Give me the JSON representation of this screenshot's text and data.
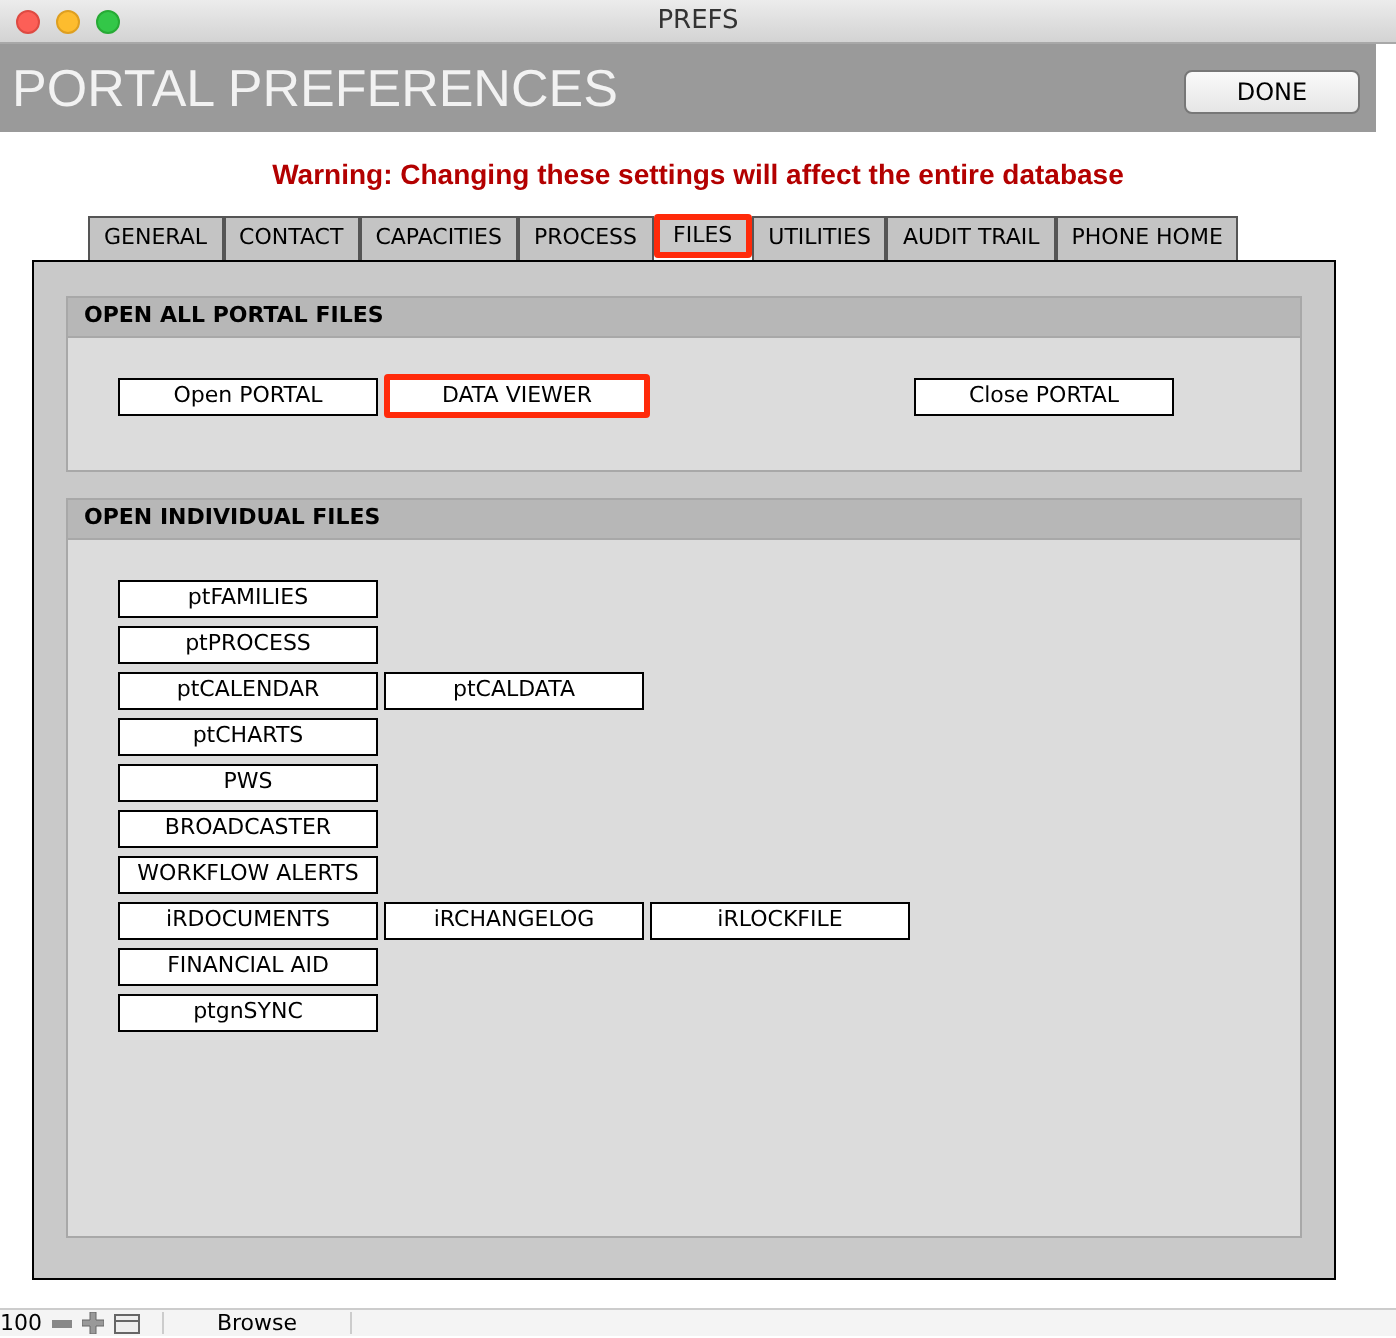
{
  "window": {
    "title": "PREFS"
  },
  "header": {
    "title": "PORTAL PREFERENCES",
    "done_button": "DONE"
  },
  "warning": "Warning: Changing these settings will affect the entire database",
  "tabs": [
    {
      "label": "GENERAL",
      "selected": false
    },
    {
      "label": "CONTACT",
      "selected": false
    },
    {
      "label": "CAPACITIES",
      "selected": false
    },
    {
      "label": "PROCESS",
      "selected": false
    },
    {
      "label": "FILES",
      "selected": true
    },
    {
      "label": "UTILITIES",
      "selected": false
    },
    {
      "label": "AUDIT TRAIL",
      "selected": false
    },
    {
      "label": "PHONE HOME",
      "selected": false
    }
  ],
  "open_all_section": {
    "title": "OPEN ALL PORTAL FILES",
    "buttons": [
      {
        "label": "Open PORTAL",
        "highlighted": false
      },
      {
        "label": "DATA VIEWER",
        "highlighted": true
      },
      {
        "label": "Close PORTAL",
        "highlighted": false
      }
    ]
  },
  "individual_section": {
    "title": "OPEN INDIVIDUAL FILES",
    "rows": [
      [
        "ptFAMILIES"
      ],
      [
        "ptPROCESS"
      ],
      [
        "ptCALENDAR",
        "ptCALDATA"
      ],
      [
        "ptCHARTS"
      ],
      [
        "PWS"
      ],
      [
        "BROADCASTER"
      ],
      [
        "WORKFLOW ALERTS"
      ],
      [
        "iRDOCUMENTS",
        "iRCHANGELOG",
        "iRLOCKFILE"
      ],
      [
        "FINANCIAL AID"
      ],
      [
        "ptgnSYNC"
      ]
    ]
  },
  "status_bar": {
    "zoom": "100",
    "mode": "Browse"
  }
}
